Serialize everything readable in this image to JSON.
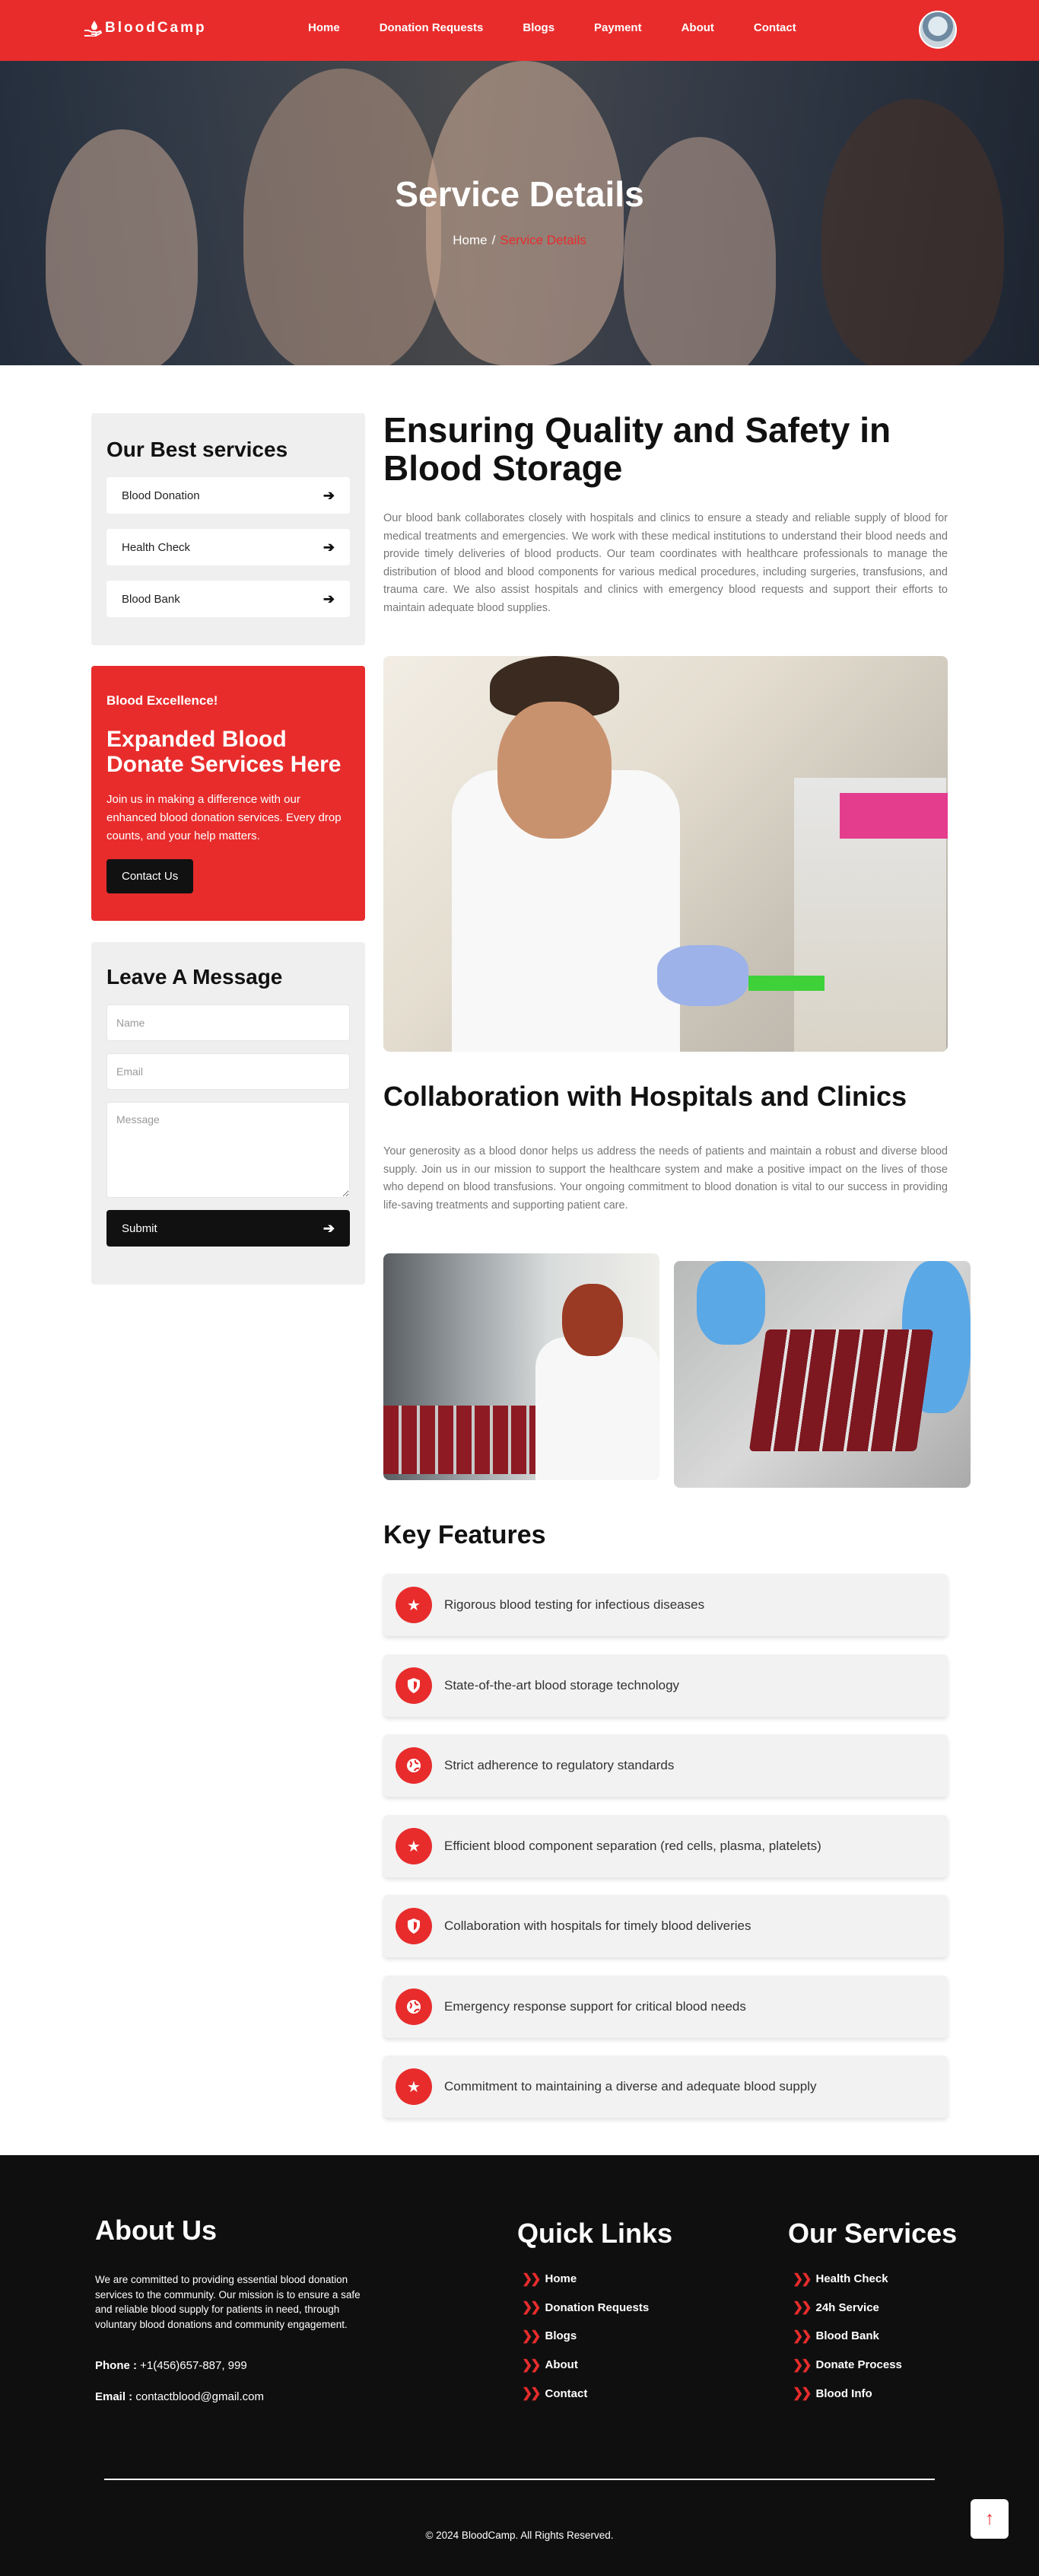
{
  "nav": {
    "brand": "BloodCamp",
    "links": [
      "Home",
      "Donation Requests",
      "Blogs",
      "Payment",
      "About",
      "Contact"
    ]
  },
  "hero": {
    "title": "Service Details",
    "crumb_home": "Home",
    "crumb_sep": "/",
    "crumb_current": "Service Details"
  },
  "sidebar": {
    "services_title": "Our Best services",
    "services": [
      "Blood Donation",
      "Health Check",
      "Blood Bank"
    ],
    "promo": {
      "eyebrow": "Blood Excellence!",
      "title": "Expanded Blood Donate Services Here",
      "text": "Join us in making a difference with our enhanced blood donation services. Every drop counts, and your help matters.",
      "button": "Contact Us"
    },
    "message": {
      "title": "Leave A Message",
      "name_placeholder": "Name",
      "email_placeholder": "Email",
      "message_placeholder": "Message",
      "submit": "Submit"
    }
  },
  "main": {
    "title": "Ensuring Quality and Safety in Blood Storage",
    "intro": "Our blood bank collaborates closely with hospitals and clinics to ensure a steady and reliable supply of blood for medical treatments and emergencies. We work with these medical institutions to understand their blood needs and provide timely deliveries of blood products. Our team coordinates with healthcare professionals to manage the distribution of blood and blood components for various medical procedures, including surgeries, transfusions, and trauma care. We also assist hospitals and clinics with emergency blood requests and support their efforts to maintain adequate blood supplies.",
    "section_title": "Collaboration with Hospitals and Clinics",
    "section_text": "Your generosity as a blood donor helps us address the needs of patients and maintain a robust and diverse blood supply. Join us in our mission to support the healthcare system and make a positive impact on the lives of those who depend on blood transfusions. Your ongoing commitment to blood donation is vital to our success in providing life-saving treatments and supporting patient care.",
    "features_title": "Key Features",
    "features": [
      {
        "icon": "star-icon",
        "text": "Rigorous blood testing for infectious diseases"
      },
      {
        "icon": "shield-icon",
        "text": "State-of-the-art blood storage technology"
      },
      {
        "icon": "globe-icon",
        "text": "Strict adherence to regulatory standards"
      },
      {
        "icon": "star-icon",
        "text": "Efficient blood component separation (red cells, plasma, platelets)"
      },
      {
        "icon": "shield-icon",
        "text": "Collaboration with hospitals for timely blood deliveries"
      },
      {
        "icon": "globe-icon",
        "text": "Emergency response support for critical blood needs"
      },
      {
        "icon": "star-icon",
        "text": "Commitment to maintaining a diverse and adequate blood supply"
      }
    ]
  },
  "footer": {
    "about_title": "About Us",
    "about_text": "We are committed to providing essential blood donation services to the community. Our mission is to ensure a safe and reliable blood supply for patients in need, through voluntary blood donations and community engagement.",
    "phone_label": "Phone :",
    "phone": "+1(456)657-887, 999",
    "email_label": "Email :",
    "email": "contactblood@gmail.com",
    "quick_title": "Quick Links",
    "quick_links": [
      "Home",
      "Donation Requests",
      "Blogs",
      "About",
      "Contact"
    ],
    "services_title": "Our Services",
    "services": [
      "Health Check",
      "24h Service",
      "Blood Bank",
      "Donate Process",
      "Blood Info"
    ],
    "copyright": "© 2024 BloodCamp. All Rights Reserved."
  },
  "colors": {
    "primary": "#e82c2c",
    "dark": "#0f0f0f",
    "panel": "#efefef"
  }
}
